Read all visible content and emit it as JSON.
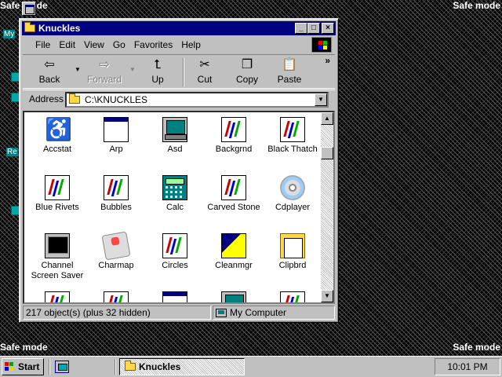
{
  "desktop": {
    "safe_mode_label": "Safe mode",
    "icon_labels": [
      "My",
      "Re"
    ]
  },
  "window": {
    "title": "Knuckles",
    "buttons": {
      "minimize": "_",
      "maximize": "□",
      "close": "×"
    },
    "menu": [
      "File",
      "Edit",
      "View",
      "Go",
      "Favorites",
      "Help"
    ],
    "toolbar": {
      "back": "Back",
      "forward": "Forward",
      "up": "Up",
      "cut": "Cut",
      "copy": "Copy",
      "paste": "Paste",
      "more": "»"
    },
    "address": {
      "label": "Address",
      "value": "C:\\KNUCKLES"
    },
    "files": [
      {
        "name": "Accstat",
        "icon": "accessibility-icon"
      },
      {
        "name": "Arp",
        "icon": "application-icon"
      },
      {
        "name": "Asd",
        "icon": "computer-icon"
      },
      {
        "name": "Backgrnd",
        "icon": "theme-icon"
      },
      {
        "name": "Black Thatch",
        "icon": "theme-icon"
      },
      {
        "name": "Blue Rivets",
        "icon": "theme-icon"
      },
      {
        "name": "Bubbles",
        "icon": "theme-icon"
      },
      {
        "name": "Calc",
        "icon": "calculator-icon"
      },
      {
        "name": "Carved Stone",
        "icon": "theme-icon"
      },
      {
        "name": "Cdplayer",
        "icon": "cd-icon"
      },
      {
        "name": "Channel Screen Saver",
        "icon": "monitor-icon"
      },
      {
        "name": "Charmap",
        "icon": "charmap-icon"
      },
      {
        "name": "Circles",
        "icon": "theme-icon"
      },
      {
        "name": "Cleanmgr",
        "icon": "cleanup-icon"
      },
      {
        "name": "Clipbrd",
        "icon": "clipboard-icon"
      }
    ],
    "status": {
      "objects": "217 object(s) (plus 32 hidden)",
      "location": "My Computer"
    }
  },
  "taskbar": {
    "start_label": "Start",
    "task_label": "Knuckles",
    "clock": "10:01 PM"
  }
}
